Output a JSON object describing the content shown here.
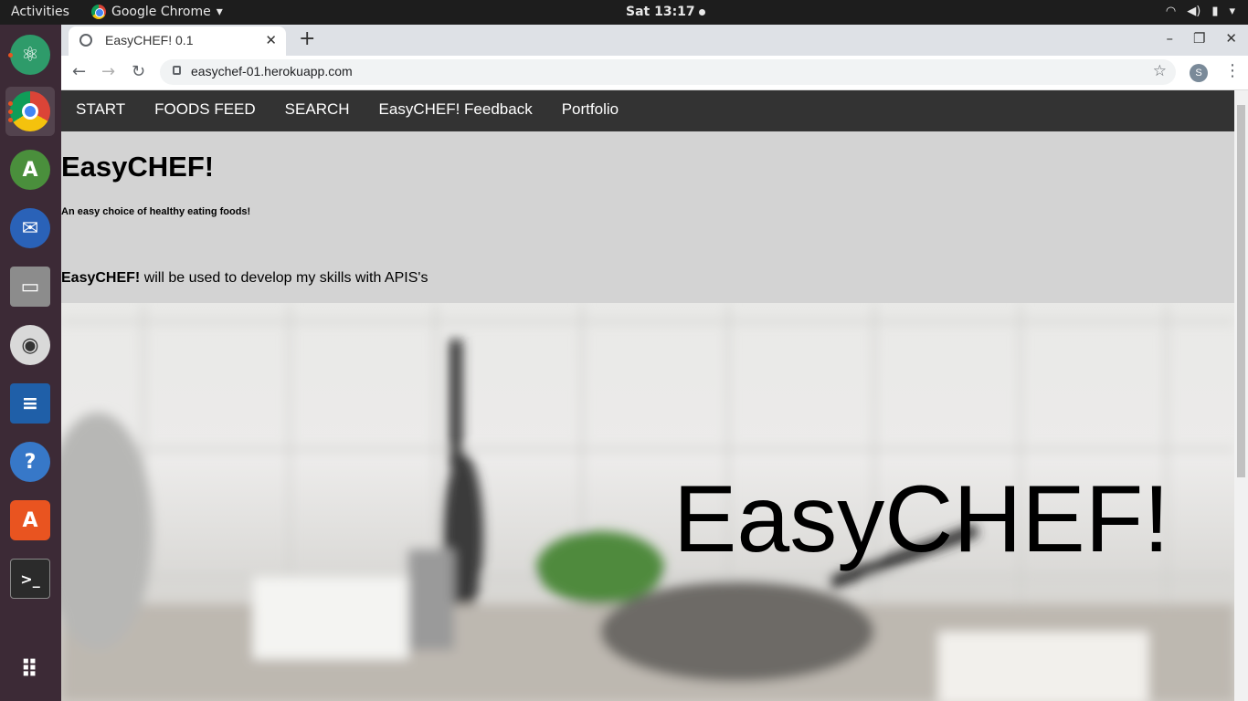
{
  "system": {
    "activities": "Activities",
    "app_name": "Google Chrome",
    "clock": "Sat 13:17"
  },
  "browser": {
    "tab_title": "EasyCHEF! 0.1",
    "url": "easychef-01.herokuapp.com",
    "profile_initial": "S"
  },
  "site": {
    "nav": [
      "START",
      "FOODS FEED",
      "SEARCH",
      "EasyCHEF! Feedback",
      "Portfolio"
    ],
    "title": "EasyCHEF!",
    "tagline": "An easy choice of healthy eating foods!",
    "intro_bold": "EasyCHEF!",
    "intro_rest": " will be used to develop my skills with APIS's",
    "hero_text": "EasyCHEF!"
  },
  "colors": {
    "nav_bg": "#333333",
    "page_bg": "#d3d3d3",
    "dock_bg": "#3c2a36"
  },
  "dock_icons": [
    "atom-icon",
    "chrome-icon",
    "android-studio-icon",
    "thunderbird-icon",
    "files-icon",
    "rhythmbox-icon",
    "writer-icon",
    "help-icon",
    "software-icon",
    "terminal-icon",
    "app-grid-icon"
  ]
}
